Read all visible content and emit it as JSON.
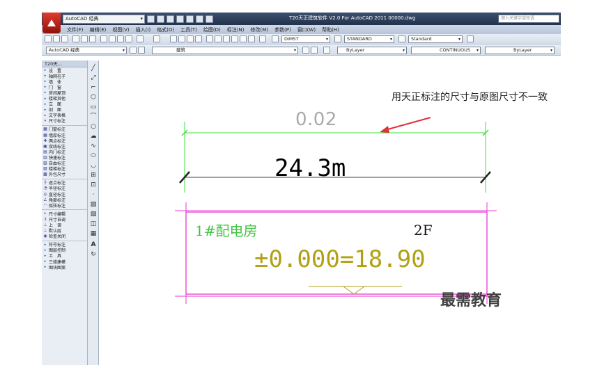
{
  "title_bar": {
    "workspace": "AutoCAD 经典",
    "title": "T20天正建筑软件 V2.0 For AutoCAD 2011    00000.dwg",
    "search_placeholder": "键入关键字或短语"
  },
  "menu": [
    "文件(F)",
    "编辑(E)",
    "视图(V)",
    "插入(I)",
    "格式(O)",
    "工具(T)",
    "绘图(D)",
    "标注(N)",
    "修改(M)",
    "参数(P)",
    "窗口(W)",
    "帮助(H)"
  ],
  "toolbar": {
    "dim_style": "DIMST",
    "text_style": "STANDARD",
    "table_style": "Standard",
    "workspace": "AutoCAD 经典",
    "layer": "建筑",
    "color": "ByLayer",
    "linetype": "CONTINUOUS",
    "lineweight": "ByLayer"
  },
  "panel": {
    "title": "T20天...",
    "groups": [
      [
        "设　置",
        "轴网柱子",
        "墙　体",
        "门　窗",
        "房间屋顶",
        "楼梯其他",
        "立　面",
        "剖　面",
        "文字表格",
        "尺寸标注"
      ],
      [
        "门窗标注",
        "墙厚标注",
        "两点标注",
        "双线标注",
        "内门标注",
        "快速标注",
        "自由标注",
        "楼梯标注",
        "外包尺寸"
      ],
      [
        "逐点标注",
        "半径标注",
        "直径标注",
        "角度标注",
        "弧弦标注"
      ],
      [
        "尺寸编辑",
        "尺寸自调",
        "上　调",
        "默认层",
        "检查关闭"
      ],
      [
        "符号标注",
        "图层控制",
        "工　具",
        "三维建模",
        "图块图案"
      ]
    ]
  },
  "drawing": {
    "dim_small": "0.02",
    "dim_main": "24.3m",
    "room_name": "1#配电房",
    "floor": "2F",
    "elevation": "±0.000=18.90",
    "annotation": "用天正标注的尺寸与原图尺寸不一致",
    "colors": {
      "dimension_line": "#3ce03c",
      "room_box": "#e838d2",
      "elevation": "#b2a014",
      "arrow": "#e0303a"
    }
  },
  "watermark": "最需教育"
}
